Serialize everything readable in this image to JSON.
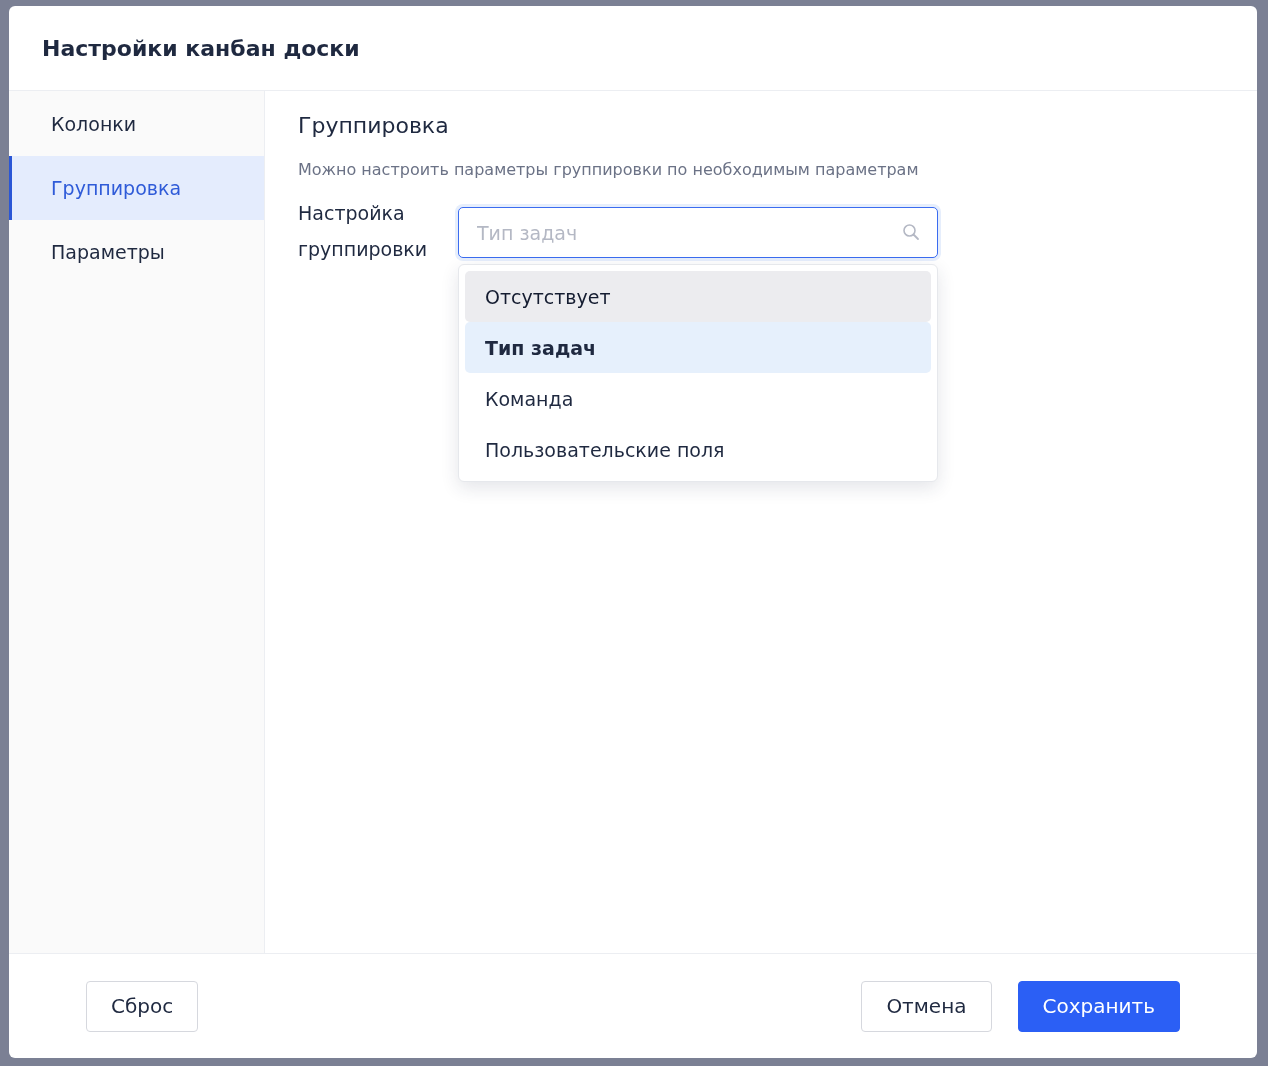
{
  "dialog": {
    "title": "Настройки канбан доски"
  },
  "sidebar": {
    "items": [
      {
        "label": "Колонки",
        "selected": false
      },
      {
        "label": "Группировка",
        "selected": true
      },
      {
        "label": "Параметры",
        "selected": false
      }
    ]
  },
  "section": {
    "title": "Группировка",
    "description": "Можно настроить параметры группировки по необходимым параметрам"
  },
  "grouping_field": {
    "label": "Настройка группировки",
    "placeholder": "Тип задач",
    "focused": true
  },
  "dropdown": {
    "options": [
      {
        "label": "Отсутствует",
        "selected": false,
        "hovered": true
      },
      {
        "label": "Тип задач",
        "selected": true,
        "hovered": false
      },
      {
        "label": "Команда",
        "selected": false,
        "hovered": false
      },
      {
        "label": "Пользовательские поля",
        "selected": false,
        "hovered": false
      }
    ]
  },
  "footer": {
    "buttons": [
      {
        "label": "Сброс",
        "kind": "secondary"
      },
      {
        "label": "Отмена",
        "kind": "secondary"
      },
      {
        "label": "Сохранить",
        "kind": "primary"
      }
    ]
  }
}
